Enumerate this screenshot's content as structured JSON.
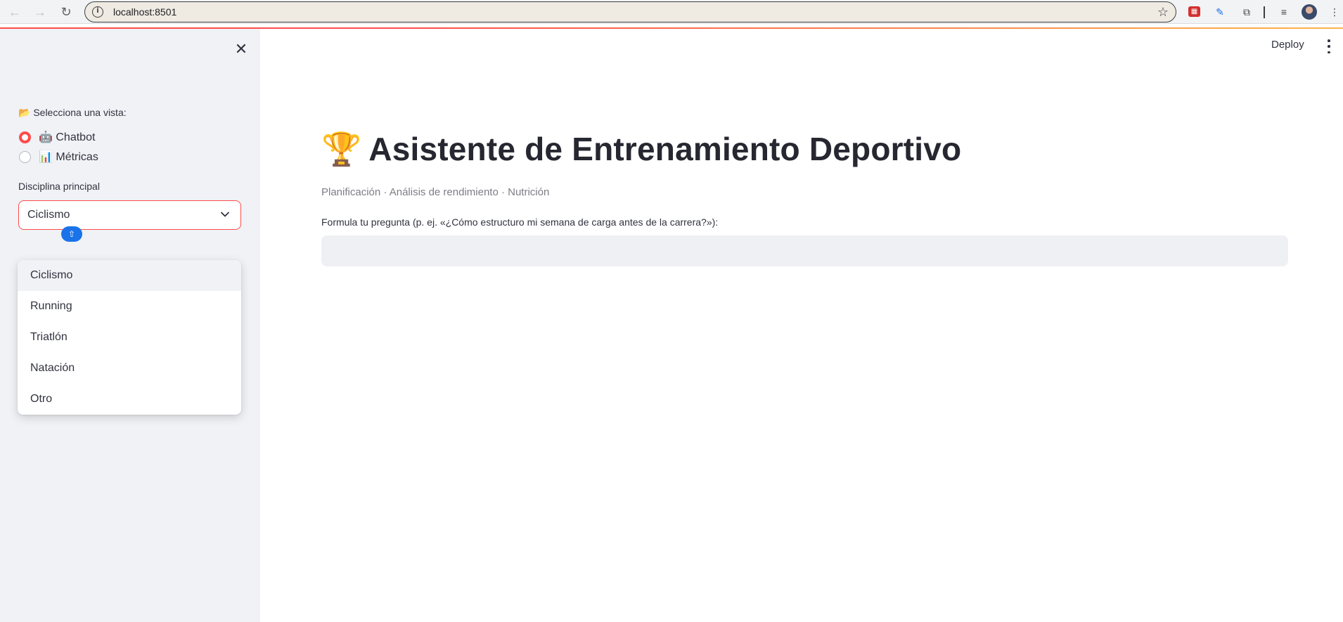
{
  "browser": {
    "url": "localhost:8501",
    "info_icon": "i",
    "back_icon": "←",
    "forward_icon": "→",
    "reload_icon": "↻",
    "star_icon": "☆"
  },
  "header": {
    "deploy_label": "Deploy"
  },
  "sidebar": {
    "close_icon": "✕",
    "view_label": "📂 Selecciona una vista:",
    "views": [
      {
        "label": "🤖 Chatbot",
        "selected": true
      },
      {
        "label": "📊 Métricas",
        "selected": false
      }
    ],
    "discipline_label": "Disciplina principal",
    "discipline_selected": "Ciclismo",
    "discipline_options": [
      "Ciclismo",
      "Running",
      "Triatlón",
      "Natación",
      "Otro"
    ]
  },
  "main": {
    "title_emoji": "🏆",
    "title": "Asistente de Entrenamiento Deportivo",
    "subtitle": "Planificación · Análisis de rendimiento · Nutrición",
    "question_label": "Formula tu pregunta (p. ej. «¿Cómo estructuro mi semana de carga antes de la carrera?»):",
    "question_value": ""
  },
  "colors": {
    "accent": "#ff4b4b",
    "sidebar_bg": "#f0f2f6",
    "text": "#31333f"
  }
}
